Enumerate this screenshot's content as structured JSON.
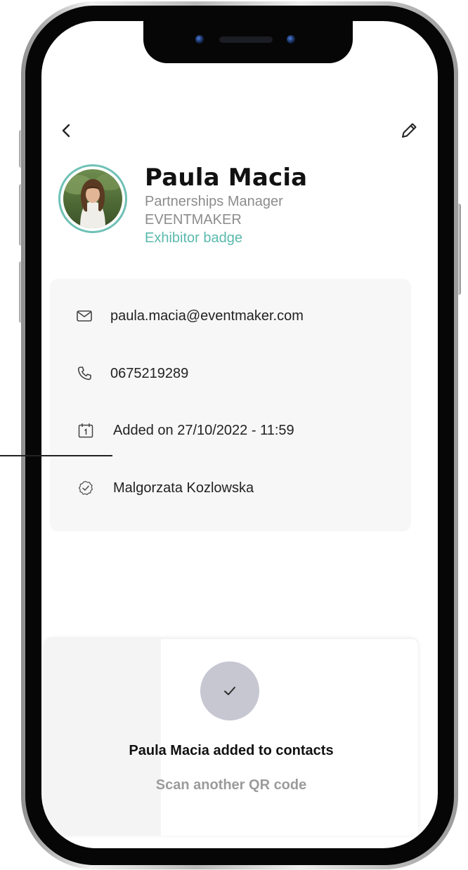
{
  "contact": {
    "name": "Paula Macia",
    "job_title": "Partnerships Manager",
    "company": "EVENTMAKER",
    "badge": "Exhibitor badge",
    "email": "paula.macia@eventmaker.com",
    "phone": "0675219289",
    "added_on": "Added on 27/10/2022 - 11:59",
    "added_by": "Malgorzata Kozlowska"
  },
  "toast": {
    "message": "Paula Macia added to contacts",
    "action_label": "Scan another QR code"
  },
  "icons": {
    "back": "chevron-left-icon",
    "edit": "pencil-icon",
    "email": "envelope-icon",
    "phone": "phone-icon",
    "date": "calendar-icon",
    "owner": "check-circle-icon",
    "confirm": "checkmark-icon"
  },
  "colors": {
    "accent": "#5ab9ad",
    "avatar_ring": "#6fc1b6",
    "card_background": "#f7f7f7",
    "check_circle": "#c6c7d1"
  }
}
